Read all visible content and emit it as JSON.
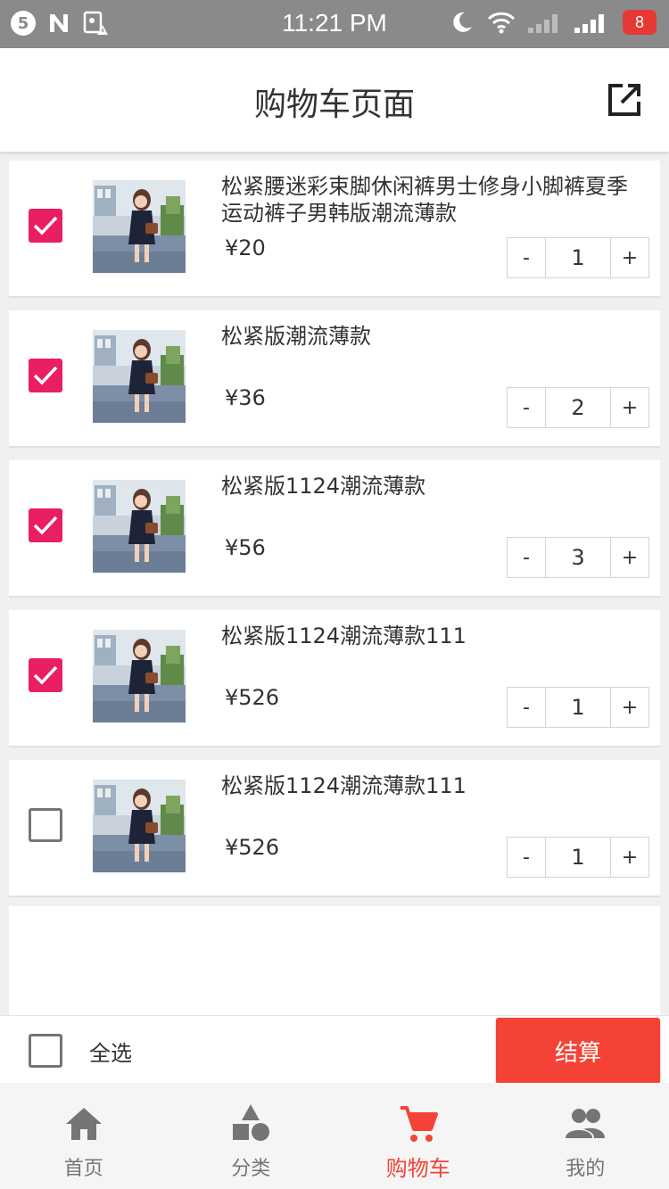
{
  "status_bar": {
    "notification_count": "5",
    "time": "11:21 PM",
    "battery": "8",
    "icons": [
      "notification-count-icon",
      "n-app-icon",
      "sd-card-warning-icon",
      "moon-icon",
      "wifi-icon",
      "signal-icon",
      "signal-icon",
      "battery-icon"
    ]
  },
  "header": {
    "title": "购物车页面",
    "share_icon": "share-external-icon"
  },
  "cart": {
    "items": [
      {
        "name": "松紧腰迷彩束脚休闲裤男士修身小脚裤夏季运动裤子男韩版潮流薄款",
        "price": "¥20",
        "quantity": "1",
        "checked": true
      },
      {
        "name": "松紧版潮流薄款",
        "price": "¥36",
        "quantity": "2",
        "checked": true
      },
      {
        "name": "松紧版1124潮流薄款",
        "price": "¥56",
        "quantity": "3",
        "checked": true
      },
      {
        "name": "松紧版1124潮流薄款111",
        "price": "¥526",
        "quantity": "1",
        "checked": true
      },
      {
        "name": "松紧版1124潮流薄款111",
        "price": "¥526",
        "quantity": "1",
        "checked": false
      }
    ],
    "minus_label": "-",
    "plus_label": "+"
  },
  "action_bar": {
    "select_all_label": "全选",
    "checkout_label": "结算"
  },
  "nav": {
    "items": [
      {
        "label": "首页",
        "icon": "home-icon",
        "active": false
      },
      {
        "label": "分类",
        "icon": "category-shapes-icon",
        "active": false
      },
      {
        "label": "购物车",
        "icon": "cart-icon",
        "active": true
      },
      {
        "label": "我的",
        "icon": "people-icon",
        "active": false
      }
    ]
  },
  "colors": {
    "status_bar": "#8a8a8a",
    "checkbox_checked": "#e91e63",
    "accent": "#f44336"
  }
}
